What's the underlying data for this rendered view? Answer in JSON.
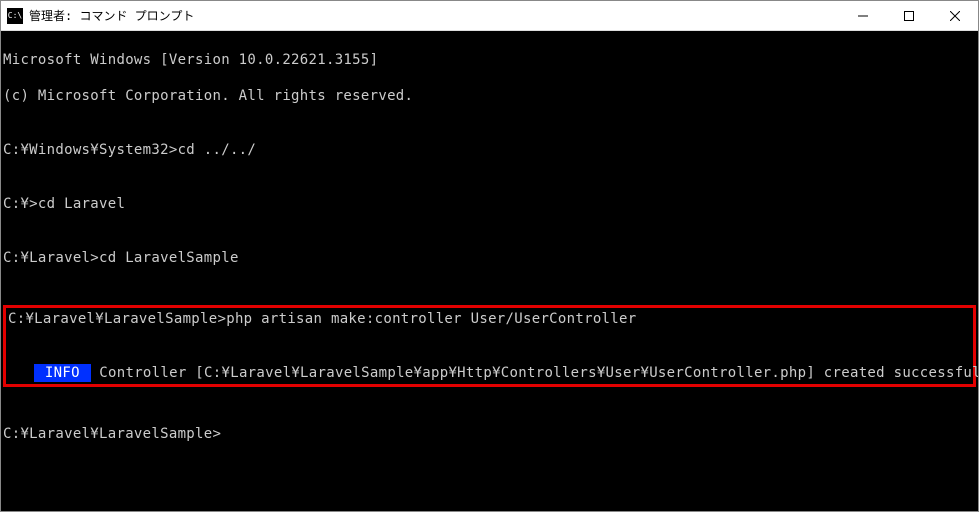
{
  "titlebar": {
    "icon_label": "C:\\",
    "title": "管理者: コマンド プロンプト"
  },
  "terminal": {
    "lines": {
      "l1": "Microsoft Windows [Version 10.0.22621.3155]",
      "l2": "(c) Microsoft Corporation. All rights reserved.",
      "l3": "",
      "l4": "C:¥Windows¥System32>cd ../../",
      "l5": "",
      "l6": "C:¥>cd Laravel",
      "l7": "",
      "l8": "C:¥Laravel>cd LaravelSample",
      "l9": "",
      "hl_cmd": "C:¥Laravel¥LaravelSample>php artisan make:controller User/UserController",
      "hl_blank": "",
      "hl_info_indent": "   ",
      "hl_info_badge": " INFO ",
      "hl_info_rest": " Controller [C:¥Laravel¥LaravelSample¥app¥Http¥Controllers¥User¥UserController.php] created successfully.",
      "after_blank": "",
      "final_prompt": "C:¥Laravel¥LaravelSample>"
    }
  }
}
